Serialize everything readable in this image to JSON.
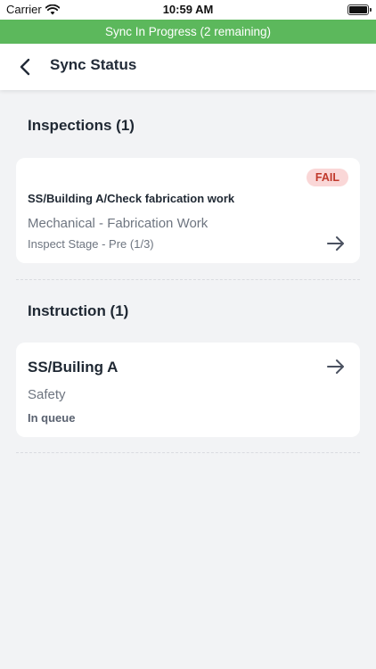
{
  "status_bar": {
    "carrier": "Carrier",
    "time": "10:59 AM"
  },
  "banner": {
    "text": "Sync In Progress (2 remaining)",
    "color": "#5cb85c"
  },
  "nav": {
    "title": "Sync Status"
  },
  "inspections": {
    "header": "Inspections (1)",
    "items": [
      {
        "badge": "FAIL",
        "path": "SS/Building A/Check fabrication work",
        "category": "Mechanical - Fabrication Work",
        "stage": "Inspect Stage - Pre (1/3)"
      }
    ]
  },
  "instruction": {
    "header": "Instruction (1)",
    "items": [
      {
        "title": "SS/Builing A",
        "category": "Safety",
        "status": "In queue"
      }
    ]
  }
}
